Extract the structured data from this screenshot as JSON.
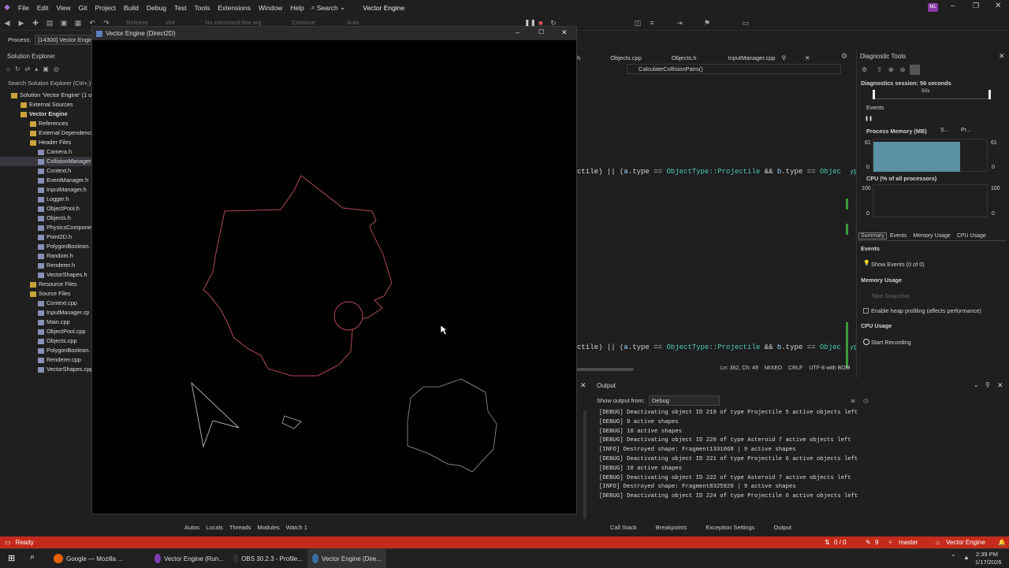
{
  "menubar": {
    "items": [
      "File",
      "Edit",
      "View",
      "Git",
      "Project",
      "Build",
      "Debug",
      "Test",
      "Tools",
      "Extensions",
      "Window",
      "Help"
    ],
    "search_label": "Search",
    "title": "Vector Engine",
    "user_initials": "ML"
  },
  "toolbar": {
    "config": "Release",
    "platform": "x64",
    "args": "No command-line arg",
    "continue": "Continue",
    "auto": "Auto"
  },
  "process": {
    "label": "Process:",
    "value": "[14300] Vector Engine"
  },
  "solution_explorer": {
    "title": "Solution Explorer",
    "search_placeholder": "Search Solution Explorer (Ctrl+;)",
    "items": [
      {
        "label": "Solution 'Vector Engine' (1 of",
        "indent": 0
      },
      {
        "label": "External Sources",
        "indent": 1
      },
      {
        "label": "Vector Engine",
        "indent": 1
      },
      {
        "label": "References",
        "indent": 2
      },
      {
        "label": "External Dependencies",
        "indent": 2
      },
      {
        "label": "Header Files",
        "indent": 2
      },
      {
        "label": "Camera.h",
        "indent": 3
      },
      {
        "label": "CollisionManager",
        "indent": 3
      },
      {
        "label": "Context.h",
        "indent": 3
      },
      {
        "label": "EventManager.h",
        "indent": 3
      },
      {
        "label": "InputManager.h",
        "indent": 3
      },
      {
        "label": "Logger.h",
        "indent": 3
      },
      {
        "label": "ObjectPool.h",
        "indent": 3
      },
      {
        "label": "Objects.h",
        "indent": 3
      },
      {
        "label": "PhysicsComponent",
        "indent": 3
      },
      {
        "label": "Point2D.h",
        "indent": 3
      },
      {
        "label": "PolygonBoolean.",
        "indent": 3
      },
      {
        "label": "Random.h",
        "indent": 3
      },
      {
        "label": "Renderer.h",
        "indent": 3
      },
      {
        "label": "VectorShapes.h",
        "indent": 3
      },
      {
        "label": "Resource Files",
        "indent": 2
      },
      {
        "label": "Source Files",
        "indent": 2
      },
      {
        "label": "Context.cpp",
        "indent": 3
      },
      {
        "label": "InputManager.cp",
        "indent": 3
      },
      {
        "label": "Main.cpp",
        "indent": 3
      },
      {
        "label": "ObjectPool.cpp",
        "indent": 3
      },
      {
        "label": "Objects.cpp",
        "indent": 3
      },
      {
        "label": "PolygonBoolean.",
        "indent": 3
      },
      {
        "label": "Renderer.cpp",
        "indent": 3
      },
      {
        "label": "VectorShapes.cpp",
        "indent": 3
      }
    ]
  },
  "editor": {
    "tabs": [
      ".h",
      "Objects.cpp",
      "Objects.h",
      "InputManager.cpp"
    ],
    "member": "CalculateCollisionPairs()",
    "line1": {
      "a": "ctile) || (",
      "b": "a",
      "c": ".type == ",
      "d": "ObjectType::Projectile",
      "e": " && ",
      "f": "b",
      ".g": "",
      "g": ".type == ",
      "h": "ObjectType:"
    },
    "line2": {
      "a": "ctile) || (",
      "b": "a",
      "c": ".type == ",
      "d": "ObjectType::Projectile",
      "e": " && ",
      "f": "b",
      "g": ".type == ",
      "h": "ObjectType:"
    },
    "status": {
      "pos": "Ln: 362, Ch: 49",
      "eol1": "MIXED",
      "eol2": "CRLF",
      "enc": "UTF-8 with BOM"
    }
  },
  "game_window": {
    "title": "Vector Engine (Direct2D)"
  },
  "diagnostics": {
    "title": "Diagnostic Tools",
    "session": "Diagnostics session: 56 seconds",
    "timeline_label": "50s",
    "events_label": "Events",
    "memory_label": "Process Memory (MB)",
    "memory_legend": [
      "S...",
      "Pr..."
    ],
    "memory_max": "61",
    "memory_min": "0",
    "cpu_label": "CPU (% of all processors)",
    "cpu_max": "100",
    "cpu_min": "0",
    "tabs": [
      "Summary",
      "Events",
      "Memory Usage",
      "CPU Usage"
    ],
    "summary": {
      "events_heading": "Events",
      "show_events": "Show Events (0 of 0)",
      "memory_heading": "Memory Usage",
      "take_snapshot": "Take Snapshot",
      "heap_profiling": "Enable heap profiling (affects performance)",
      "cpu_heading": "CPU Usage",
      "start_recording": "Start Recording"
    },
    "colors": {
      "memory_fill": "#5b8fa3"
    }
  },
  "output": {
    "title": "Output",
    "show_from_label": "Show output from:",
    "show_from_value": "Debug",
    "lines": [
      "[DEBUG] Deactivating object ID 219 of type Projectile 5 active objects left",
      "[DEBUG] 9 active shapes",
      "[DEBUG] 10 active shapes",
      "[DEBUG] Deactivating object ID 220 of type Asteroid 7 active objects left",
      "[INFO] Destroyed shape: Fragment1331068 | 9 active shapes",
      "[DEBUG] Deactivating object ID 221 of type Projectile 6 active objects left",
      "[DEBUG] 10 active shapes",
      "[DEBUG] Deactivating object ID 222 of type Asteroid 7 active objects left",
      "[INFO] Destroyed shape: Fragment8325920 | 9 active shapes",
      "[DEBUG] Deactivating object ID 224 of type Projectile 6 active objects left"
    ]
  },
  "bottom_tabs_left": [
    "Autos",
    "Locals",
    "Threads",
    "Modules",
    "Watch 1"
  ],
  "bottom_tabs_right": [
    "Call Stack",
    "Breakpoints",
    "Exception Settings",
    "Output"
  ],
  "statusbar": {
    "ready": "Ready",
    "sync": "0 / 0",
    "changes": "9",
    "branch": "master",
    "repo": "Vector Engine",
    "color": "#c42b1c"
  },
  "taskbar": {
    "apps": [
      "Google — Mozilla ...",
      "Vector Engine (Run...",
      "OBS 30.2.3 - Profile...",
      "Vector Engine (Dire..."
    ],
    "time": "2:39 PM",
    "date": "1/17/2026"
  }
}
